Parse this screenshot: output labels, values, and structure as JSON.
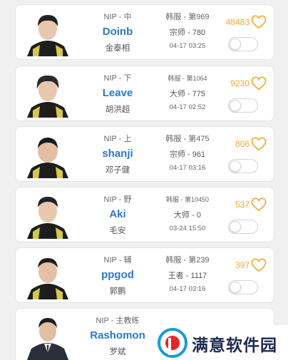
{
  "players": [
    {
      "team_role": "NIP - 中",
      "name": "Doinb",
      "real_name": "金泰相",
      "server": "韩服 - 第969",
      "tier": "宗师 - 780",
      "time": "04-17 03:25",
      "likes": "48483",
      "server_small": false
    },
    {
      "team_role": "NIP - 下",
      "name": "Leave",
      "real_name": "胡洪超",
      "server": "韩服 - 第1064",
      "tier": "大师 - 775",
      "time": "04-17 02:52",
      "likes": "9230",
      "server_small": true
    },
    {
      "team_role": "NIP - 上",
      "name": "shanji",
      "real_name": "邓子健",
      "server": "韩服 - 第475",
      "tier": "宗师 - 961",
      "time": "04-17 03:16",
      "likes": "806",
      "server_small": false
    },
    {
      "team_role": "NIP - 野",
      "name": "Aki",
      "real_name": "毛安",
      "server": "韩服 - 第10450",
      "tier": "大师 - 0",
      "time": "03-24 15:50",
      "likes": "537",
      "server_small": true
    },
    {
      "team_role": "NIP - 辅",
      "name": "ppgod",
      "real_name": "郭鹏",
      "server": "韩服 - 第239",
      "tier": "王者 - 1117",
      "time": "04-17 03:16",
      "likes": "397",
      "server_small": false
    },
    {
      "team_role": "NIP - 主教练",
      "name": "Rashomon",
      "real_name": "罗斌",
      "server": "",
      "tier": "",
      "time": "",
      "likes": "",
      "server_small": false
    }
  ],
  "watermark": {
    "text": "满意软件园"
  },
  "colors": {
    "name": "#2b78c8",
    "likes": "#f0a830",
    "heart": "#f0a830",
    "watermark_red": "#e8242b",
    "watermark_blue": "#1a9ad6"
  },
  "icons": {
    "like": "heart-outline-icon",
    "toggle": "toggle-switch"
  }
}
